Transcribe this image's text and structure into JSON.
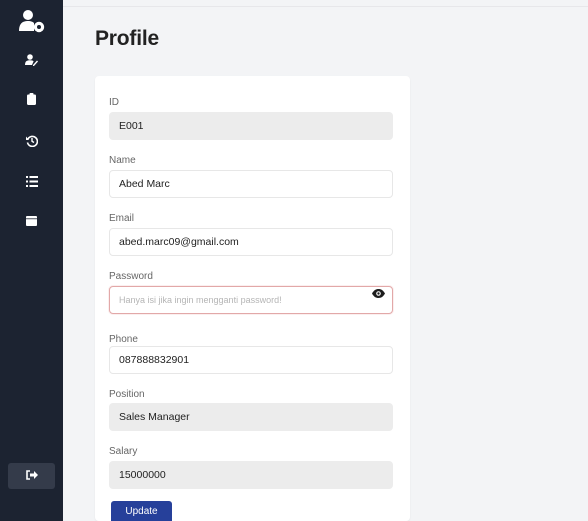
{
  "page": {
    "title": "Profile"
  },
  "sidebar": {
    "logo_icon": "user-gear-icon",
    "items": [
      {
        "icon": "user-edit-icon"
      },
      {
        "icon": "clipboard-icon"
      },
      {
        "icon": "history-icon"
      },
      {
        "icon": "list-icon"
      },
      {
        "icon": "calendar-icon"
      }
    ],
    "logout_icon": "logout-icon"
  },
  "form": {
    "id": {
      "label": "ID",
      "value": "E001"
    },
    "name": {
      "label": "Name",
      "value": "Abed Marc"
    },
    "email": {
      "label": "Email",
      "value": "abed.marc09@gmail.com"
    },
    "password": {
      "label": "Password",
      "value": "",
      "placeholder": "Hanya isi jika ingin mengganti password!"
    },
    "phone": {
      "label": "Phone",
      "value": "087888832901"
    },
    "position": {
      "label": "Position",
      "value": "Sales Manager"
    },
    "salary": {
      "label": "Salary",
      "value": "15000000"
    },
    "submit_label": "Update"
  },
  "colors": {
    "sidebar_bg": "#1c2331",
    "primary": "#26409a",
    "error_border": "#e2a8a8",
    "readonly_bg": "#ececec"
  }
}
